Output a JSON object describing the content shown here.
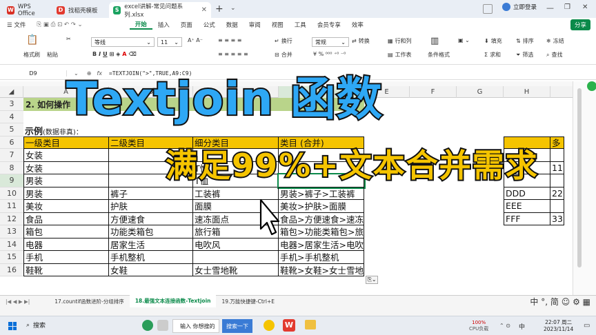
{
  "tabs": [
    {
      "label": "WPS Office",
      "icon": "wps-icon",
      "color": "#d93025"
    },
    {
      "label": "找稻壳模板",
      "icon": "docer-icon",
      "color": "#e23a2f"
    },
    {
      "label": "excel讲解-常见问题系列.xlsx",
      "icon": "sheet-icon",
      "color": "#1aa260"
    }
  ],
  "titlebar": {
    "login": "立即登录"
  },
  "menu": {
    "file": "文件",
    "items": [
      "开始",
      "插入",
      "页面",
      "公式",
      "数据",
      "审阅",
      "视图",
      "工具",
      "会员专享",
      "效率"
    ],
    "share": "分享"
  },
  "ribbon": {
    "format_painter": "格式刷",
    "paste": "粘贴",
    "font_name": "等线",
    "font_size": "11",
    "wrap": "换行",
    "merge": "合并",
    "number_format": "常规",
    "convert": "转换",
    "rows_cols": "行和列",
    "worksheet": "工作表",
    "cond_format": "条件格式",
    "fill": "填充",
    "sum": "求和",
    "sort": "排序",
    "filter": "筛选",
    "freeze": "冻结",
    "find": "查找"
  },
  "formula": {
    "cell_ref": "D9",
    "fx": "fx",
    "text": "=TEXTJOIN(\">\",TRUE,A9:C9)"
  },
  "columns": [
    "A",
    "B",
    "C",
    "D",
    "E",
    "F",
    "G",
    "H"
  ],
  "rows": [
    "3",
    "4",
    "5",
    "6",
    "7",
    "8",
    "9",
    "10",
    "11",
    "12",
    "13",
    "14",
    "15",
    "16"
  ],
  "sheet": {
    "r3": "2. 如何操作",
    "r5_label": "示例",
    "r5_note": "(数据非真)：",
    "header": [
      "一级类目",
      "二级类目",
      "细分类目",
      "类目 (合并)"
    ],
    "data": [
      [
        "女装",
        "",
        "",
        ""
      ],
      [
        "女装",
        "",
        "T恤",
        ""
      ],
      [
        "男装",
        "",
        "T恤",
        ""
      ],
      [
        "男装",
        "裤子",
        "工装裤",
        "男装>裤子>工装裤"
      ],
      [
        "美妆",
        "护肤",
        "面膜",
        "美妆>护肤>面膜"
      ],
      [
        "食品",
        "方便速食",
        "速冻面点",
        "食品>方便速食>速冻面点"
      ],
      [
        "箱包",
        "功能类箱包",
        "旅行箱",
        "箱包>功能类箱包>旅行箱"
      ],
      [
        "电器",
        "居家生活",
        "电吹风",
        "电器>居家生活>电吹风"
      ],
      [
        "手机",
        "手机整机",
        "",
        "手机>手机整机"
      ],
      [
        "鞋靴",
        "女鞋",
        "女士雪地靴",
        "鞋靴>女鞋>女士雪地靴"
      ]
    ],
    "side_header": "多",
    "side": [
      [
        "",
        ""
      ],
      [
        "",
        "11"
      ],
      [
        "",
        ""
      ],
      [
        "DDD",
        "22"
      ],
      [
        "EEE",
        ""
      ],
      [
        "FFF",
        "33"
      ]
    ]
  },
  "overlay": {
    "title": "Textjoin 函数",
    "subtitle": "满足99%+文本合并需求"
  },
  "sheet_tabs": [
    "17.countif函数进阶-分组排序",
    "18.最强文本连接函数-Textjoin",
    "19.万能快捷键-Ctrl+E"
  ],
  "status": {
    "ime": "中",
    "punct": "°,",
    "mode": "简"
  },
  "taskbar": {
    "search": "搜索",
    "input_hint": "输入 你想搜的",
    "search_btn": "搜索一下",
    "cpu_pct": "100%",
    "cpu_label": "CPU负载",
    "time": "22:07 周二",
    "date": "2023/11/14",
    "lang": "中"
  }
}
